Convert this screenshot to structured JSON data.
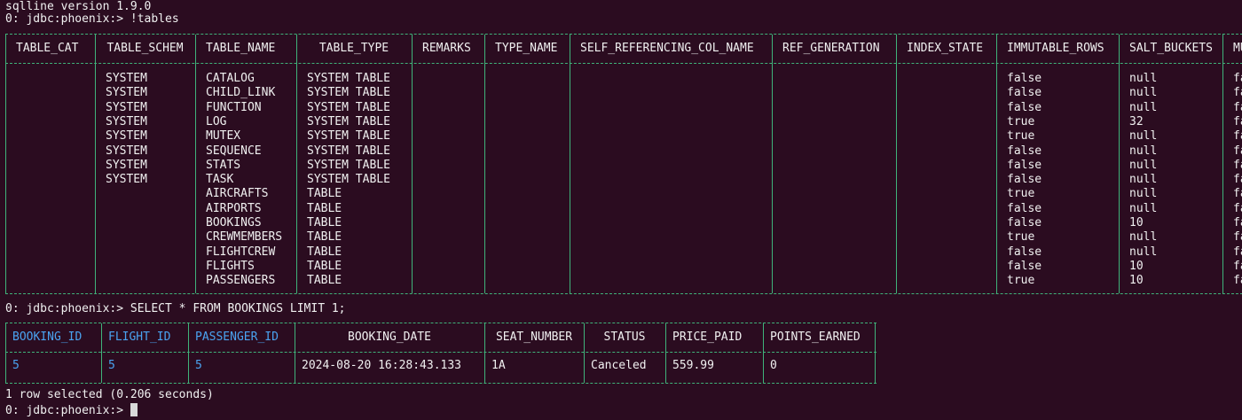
{
  "header": {
    "version_line": "sqlline version 1.9.0",
    "prompt1": "0: jdbc:phoenix:> !tables"
  },
  "tables_result": {
    "columns": [
      "TABLE_CAT",
      "TABLE_SCHEM",
      "TABLE_NAME",
      "TABLE_TYPE",
      "REMARKS",
      "TYPE_NAME",
      "SELF_REFERENCING_COL_NAME",
      "REF_GENERATION",
      "INDEX_STATE",
      "IMMUTABLE_ROWS",
      "SALT_BUCKETS",
      "MU"
    ],
    "rows": [
      [
        "",
        "SYSTEM",
        "CATALOG",
        "SYSTEM TABLE",
        "",
        "",
        "",
        "",
        "",
        "false",
        "null",
        "fa"
      ],
      [
        "",
        "SYSTEM",
        "CHILD_LINK",
        "SYSTEM TABLE",
        "",
        "",
        "",
        "",
        "",
        "false",
        "null",
        "fa"
      ],
      [
        "",
        "SYSTEM",
        "FUNCTION",
        "SYSTEM TABLE",
        "",
        "",
        "",
        "",
        "",
        "false",
        "null",
        "fa"
      ],
      [
        "",
        "SYSTEM",
        "LOG",
        "SYSTEM TABLE",
        "",
        "",
        "",
        "",
        "",
        "true",
        "32",
        "fa"
      ],
      [
        "",
        "SYSTEM",
        "MUTEX",
        "SYSTEM TABLE",
        "",
        "",
        "",
        "",
        "",
        "true",
        "null",
        "fa"
      ],
      [
        "",
        "SYSTEM",
        "SEQUENCE",
        "SYSTEM TABLE",
        "",
        "",
        "",
        "",
        "",
        "false",
        "null",
        "fa"
      ],
      [
        "",
        "SYSTEM",
        "STATS",
        "SYSTEM TABLE",
        "",
        "",
        "",
        "",
        "",
        "false",
        "null",
        "fa"
      ],
      [
        "",
        "SYSTEM",
        "TASK",
        "SYSTEM TABLE",
        "",
        "",
        "",
        "",
        "",
        "false",
        "null",
        "fa"
      ],
      [
        "",
        "",
        "AIRCRAFTS",
        "TABLE",
        "",
        "",
        "",
        "",
        "",
        "true",
        "null",
        "fa"
      ],
      [
        "",
        "",
        "AIRPORTS",
        "TABLE",
        "",
        "",
        "",
        "",
        "",
        "false",
        "null",
        "fa"
      ],
      [
        "",
        "",
        "BOOKINGS",
        "TABLE",
        "",
        "",
        "",
        "",
        "",
        "false",
        "10",
        "fa"
      ],
      [
        "",
        "",
        "CREWMEMBERS",
        "TABLE",
        "",
        "",
        "",
        "",
        "",
        "true",
        "null",
        "fa"
      ],
      [
        "",
        "",
        "FLIGHTCREW",
        "TABLE",
        "",
        "",
        "",
        "",
        "",
        "false",
        "null",
        "fa"
      ],
      [
        "",
        "",
        "FLIGHTS",
        "TABLE",
        "",
        "",
        "",
        "",
        "",
        "false",
        "10",
        "fa"
      ],
      [
        "",
        "",
        "PASSENGERS",
        "TABLE",
        "",
        "",
        "",
        "",
        "",
        "true",
        "10",
        "fa"
      ]
    ]
  },
  "query": {
    "prompt": "0: jdbc:phoenix:> SELECT * FROM BOOKINGS LIMIT 1;",
    "columns": [
      "BOOKING_ID",
      "FLIGHT_ID",
      "PASSENGER_ID",
      "BOOKING_DATE",
      "SEAT_NUMBER",
      "STATUS",
      "PRICE_PAID",
      "POINTS_EARNED"
    ],
    "row": [
      "5",
      "5",
      "5",
      "2024-08-20 16:28:43.133",
      "1A",
      "Canceled",
      "559.99",
      "0"
    ],
    "summary": "1 row selected (0.206 seconds)",
    "final_prompt": "0: jdbc:phoenix:> "
  },
  "colors": {
    "background": "#2b0c20",
    "border": "#3fb37a",
    "key_column": "#4aa3f0",
    "text": "#f0f0f0"
  }
}
